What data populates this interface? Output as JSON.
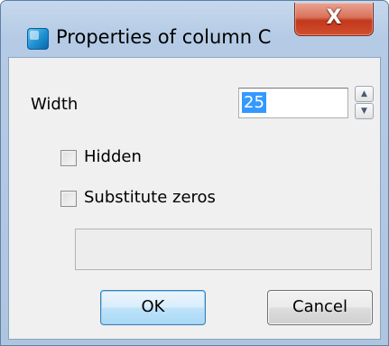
{
  "window": {
    "title": "Properties of column C",
    "close_glyph": "X"
  },
  "fields": {
    "width_label": "Width",
    "width_value": "25",
    "hidden_label": "Hidden",
    "hidden_checked": false,
    "substitute_zeros_label": "Substitute zeros",
    "substitute_zeros_checked": false,
    "substitute_value": ""
  },
  "spinner": {
    "up_glyph": "▲",
    "down_glyph": "▼"
  },
  "buttons": {
    "ok": "OK",
    "cancel": "Cancel"
  },
  "icons": {
    "app": "app-icon",
    "close": "close-icon",
    "spin_up": "spin-up-icon",
    "spin_down": "spin-down-icon"
  },
  "colors": {
    "selection": "#3399ff",
    "close_button": "#c2381b",
    "title_bar": "#b5cbe5"
  }
}
